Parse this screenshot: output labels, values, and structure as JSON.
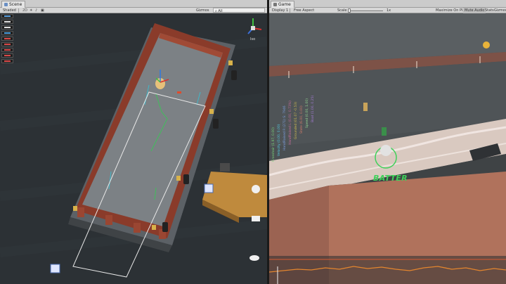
{
  "scene": {
    "tab_label": "Scene",
    "shading_mode": "Shaded",
    "gizmos_label": "Gizmos",
    "all_filter": "All",
    "projection_label": "Iso",
    "colors": {
      "background": "#2c3135",
      "boat_rim": "#8a3b2a",
      "boat_floor": "#7c8185",
      "selection_box": "#e8e8e8"
    }
  },
  "game": {
    "tab_label": "Game",
    "display_label": "Display 1",
    "aspect_label": "Free Aspect",
    "scale_label": "Scale",
    "scale_value": "1x",
    "maximize_label": "Maximize On Play",
    "mute_label": "Mute Audio",
    "stats_label": "Stats",
    "gizmos_label": "Gizmos",
    "player_tag": "BATTER",
    "debug_lines": [
      {
        "text": "Crosshair (1.97, 0.00)",
        "color": "#7ad37a"
      },
      {
        "text": "Velocity (0.00, 0.00)",
        "color": "#55c9e0"
      },
      {
        "text": "HandRaised R (271)  S: 7946",
        "color": "#7a9ad8"
      },
      {
        "text": "HandRaised L (0.00, 0.73%)",
        "color": "#c46a9a"
      },
      {
        "text": "Grounded (01.07 -0.53)",
        "color": "#c6b44f"
      },
      {
        "text": "State (6.00, 0.00)",
        "color": "#d07a6a"
      },
      {
        "text": "Speed (0.00, 1.00)",
        "color": "#8fd08f"
      },
      {
        "text": "Boat (1.00, 0.25)",
        "color": "#a07ad0"
      }
    ],
    "colors": {
      "river": "#d9c9c0",
      "deck": "#b0725c",
      "wall": "#7d5247",
      "tag": "#3fd15a",
      "graph": "#e3852e"
    }
  }
}
